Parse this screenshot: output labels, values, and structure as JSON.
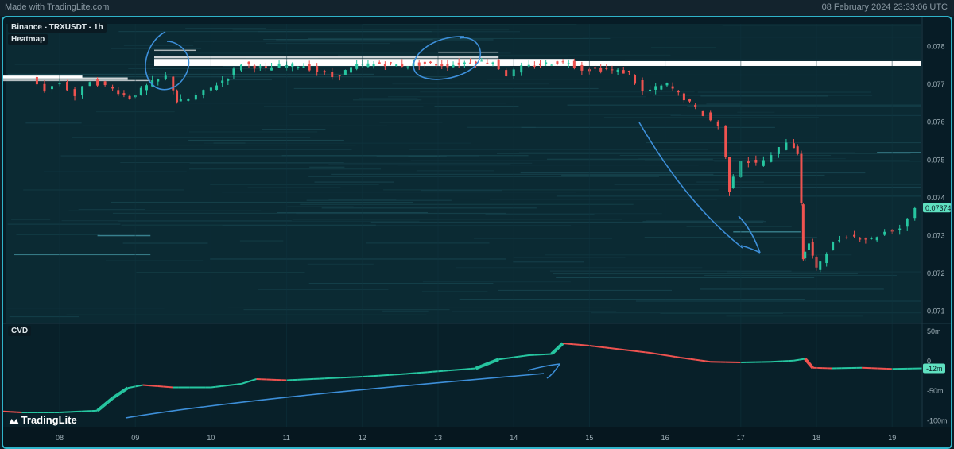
{
  "header": {
    "made_with": "Made with TradingLite.com",
    "datetime": "08 February 2024 23:33:06 UTC"
  },
  "panels": {
    "main_title": "Binance - TRXUSDT - 1h",
    "main_subtitle": "Heatmap",
    "cvd_title": "CVD"
  },
  "brand": "TradingLite",
  "colors": {
    "up": "#26c6a0",
    "down": "#ef5350",
    "accent": "#2fb3c9",
    "annotation": "#3d8fd9"
  },
  "chart_data": [
    {
      "type": "candlestick",
      "title": "Binance - TRXUSDT - 1h",
      "x_ticks": [
        "08",
        "09",
        "10",
        "11",
        "12",
        "13",
        "14",
        "15",
        "16",
        "17",
        "18",
        "19"
      ],
      "y_ticks": [
        "0.078",
        "0.077",
        "0.076",
        "0.075",
        "0.074",
        "0.073",
        "0.072",
        "0.071"
      ],
      "ylim": [
        0.0707,
        0.0786
      ],
      "current_price": "0.07374",
      "series": [
        {
          "x": 7.7,
          "y": 0.07715
        },
        {
          "x": 7.9,
          "y": 0.07685
        },
        {
          "x": 8.1,
          "y": 0.07705
        },
        {
          "x": 8.3,
          "y": 0.0767
        },
        {
          "x": 8.5,
          "y": 0.0771
        },
        {
          "x": 8.7,
          "y": 0.07695
        },
        {
          "x": 9.0,
          "y": 0.07665
        },
        {
          "x": 9.3,
          "y": 0.07705
        },
        {
          "x": 9.5,
          "y": 0.0772
        },
        {
          "x": 9.6,
          "y": 0.07655
        },
        {
          "x": 9.8,
          "y": 0.0766
        },
        {
          "x": 10.0,
          "y": 0.0768
        },
        {
          "x": 10.3,
          "y": 0.0772
        },
        {
          "x": 10.5,
          "y": 0.07755
        },
        {
          "x": 10.8,
          "y": 0.0774
        },
        {
          "x": 11.0,
          "y": 0.0775
        },
        {
          "x": 11.3,
          "y": 0.0775
        },
        {
          "x": 11.5,
          "y": 0.07735
        },
        {
          "x": 11.7,
          "y": 0.0772
        },
        {
          "x": 12.0,
          "y": 0.0775
        },
        {
          "x": 12.3,
          "y": 0.07755
        },
        {
          "x": 12.6,
          "y": 0.0775
        },
        {
          "x": 12.9,
          "y": 0.07755
        },
        {
          "x": 13.2,
          "y": 0.0775
        },
        {
          "x": 13.5,
          "y": 0.0776
        },
        {
          "x": 13.8,
          "y": 0.0776
        },
        {
          "x": 14.0,
          "y": 0.07725
        },
        {
          "x": 14.2,
          "y": 0.07745
        },
        {
          "x": 14.5,
          "y": 0.07755
        },
        {
          "x": 14.8,
          "y": 0.0776
        },
        {
          "x": 15.0,
          "y": 0.0774
        },
        {
          "x": 15.3,
          "y": 0.0774
        },
        {
          "x": 15.6,
          "y": 0.0773
        },
        {
          "x": 15.8,
          "y": 0.0768
        },
        {
          "x": 16.1,
          "y": 0.077
        },
        {
          "x": 16.4,
          "y": 0.0765
        },
        {
          "x": 16.6,
          "y": 0.0762
        },
        {
          "x": 16.8,
          "y": 0.0759
        },
        {
          "x": 16.9,
          "y": 0.0742
        },
        {
          "x": 17.1,
          "y": 0.075
        },
        {
          "x": 17.3,
          "y": 0.0749
        },
        {
          "x": 17.5,
          "y": 0.0751
        },
        {
          "x": 17.7,
          "y": 0.0755
        },
        {
          "x": 17.8,
          "y": 0.0752
        },
        {
          "x": 17.85,
          "y": 0.0724
        },
        {
          "x": 17.95,
          "y": 0.0728
        },
        {
          "x": 18.05,
          "y": 0.0721
        },
        {
          "x": 18.3,
          "y": 0.0728
        },
        {
          "x": 18.5,
          "y": 0.073
        },
        {
          "x": 18.8,
          "y": 0.0729
        },
        {
          "x": 19.0,
          "y": 0.0731
        },
        {
          "x": 19.2,
          "y": 0.0732
        },
        {
          "x": 19.4,
          "y": 0.07374
        }
      ],
      "heatmap_levels": [
        {
          "price": 0.07755,
          "x_start": 9.25,
          "x_end": 19.4,
          "strength": 1.0
        },
        {
          "price": 0.07764,
          "x_start": 9.25,
          "x_end": 14.8,
          "strength": 0.85
        },
        {
          "price": 0.07772,
          "x_start": 9.25,
          "x_end": 13.8,
          "strength": 0.6
        },
        {
          "price": 0.0779,
          "x_start": 9.25,
          "x_end": 9.8,
          "strength": 0.45
        },
        {
          "price": 0.07785,
          "x_start": 13.0,
          "x_end": 13.8,
          "strength": 0.5
        },
        {
          "price": 0.0772,
          "x_start": 7.1,
          "x_end": 8.3,
          "strength": 0.9
        },
        {
          "price": 0.07715,
          "x_start": 7.1,
          "x_end": 8.9,
          "strength": 0.6
        },
        {
          "price": 0.0771,
          "x_start": 7.1,
          "x_end": 9.2,
          "strength": 0.5
        },
        {
          "price": 0.073,
          "x_start": 8.5,
          "x_end": 9.2,
          "strength": 0.35
        },
        {
          "price": 0.0731,
          "x_start": 16.9,
          "x_end": 17.8,
          "strength": 0.3
        },
        {
          "price": 0.0752,
          "x_start": 18.8,
          "x_end": 19.4,
          "strength": 0.25
        },
        {
          "price": 0.0725,
          "x_start": 7.4,
          "x_end": 9.2,
          "strength": 0.3
        }
      ]
    },
    {
      "type": "line",
      "title": "CVD",
      "y_ticks": [
        "50m",
        "0",
        "-50m",
        "-100m"
      ],
      "ylim": [
        -110,
        62
      ],
      "current_value": "-12m",
      "series": [
        {
          "x": 7.05,
          "y": -83
        },
        {
          "x": 7.5,
          "y": -86
        },
        {
          "x": 8.0,
          "y": -86
        },
        {
          "x": 8.5,
          "y": -83
        },
        {
          "x": 8.7,
          "y": -62
        },
        {
          "x": 8.9,
          "y": -45
        },
        {
          "x": 9.1,
          "y": -40
        },
        {
          "x": 9.5,
          "y": -44
        },
        {
          "x": 10.0,
          "y": -44
        },
        {
          "x": 10.4,
          "y": -38
        },
        {
          "x": 10.6,
          "y": -30
        },
        {
          "x": 11.0,
          "y": -32
        },
        {
          "x": 11.5,
          "y": -29
        },
        {
          "x": 12.0,
          "y": -26
        },
        {
          "x": 12.5,
          "y": -22
        },
        {
          "x": 13.0,
          "y": -17
        },
        {
          "x": 13.5,
          "y": -12
        },
        {
          "x": 13.8,
          "y": 3
        },
        {
          "x": 14.2,
          "y": 10
        },
        {
          "x": 14.5,
          "y": 12
        },
        {
          "x": 14.65,
          "y": 30
        },
        {
          "x": 15.0,
          "y": 26
        },
        {
          "x": 15.4,
          "y": 20
        },
        {
          "x": 15.8,
          "y": 14
        },
        {
          "x": 16.2,
          "y": 6
        },
        {
          "x": 16.6,
          "y": -1
        },
        {
          "x": 17.0,
          "y": -2
        },
        {
          "x": 17.4,
          "y": -1
        },
        {
          "x": 17.7,
          "y": 1
        },
        {
          "x": 17.85,
          "y": 4
        },
        {
          "x": 17.95,
          "y": -11
        },
        {
          "x": 18.2,
          "y": -12
        },
        {
          "x": 18.6,
          "y": -11
        },
        {
          "x": 19.0,
          "y": -13
        },
        {
          "x": 19.4,
          "y": -12
        }
      ]
    }
  ]
}
